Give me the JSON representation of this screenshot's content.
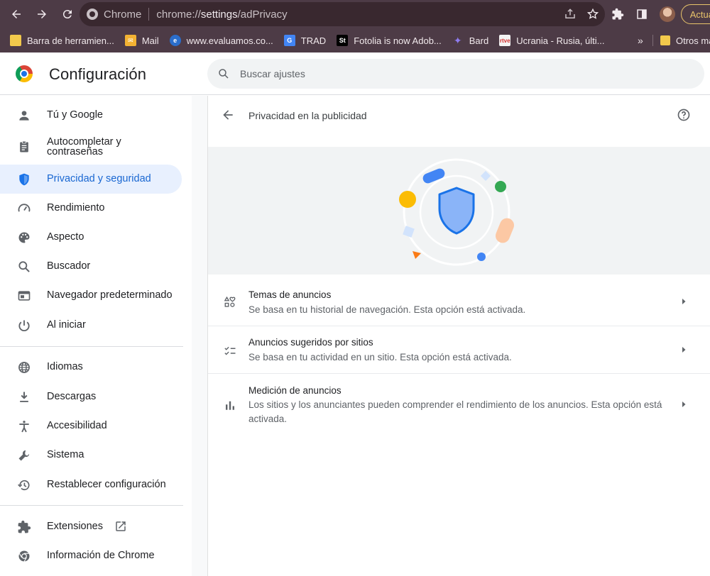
{
  "browser": {
    "omnibox": {
      "chip": "Chrome",
      "url_prefix": "chrome://",
      "url_host": "settings",
      "url_path": "/adPrivacy"
    },
    "update_label": "Actua"
  },
  "bookmarks": {
    "items": [
      {
        "label": "Barra de herramien...",
        "icon": "folder-icon",
        "color": "#f2c94c"
      },
      {
        "label": "Mail",
        "icon": "mail-icon",
        "color": "#f2b233"
      },
      {
        "label": "www.evaluamos.co...",
        "icon": "edge-e-icon",
        "color": "#2b6ecb"
      },
      {
        "label": "TRAD",
        "icon": "translate-icon",
        "color": "#4285f4"
      },
      {
        "label": "Fotolia is now Adob...",
        "icon": "stock-icon",
        "color": "#000000"
      },
      {
        "label": "Bard",
        "icon": "bard-sparkle-icon",
        "color": "#8e7cf0"
      },
      {
        "label": "Ucrania - Rusia, últi...",
        "icon": "rtve-icon",
        "color": "#f4f4f4"
      }
    ],
    "overflow": "»",
    "other_label": "Otros ma"
  },
  "settings": {
    "title": "Configuración",
    "search_placeholder": "Buscar ajustes"
  },
  "sidebar": {
    "items": [
      {
        "label": "Tú y Google",
        "icon": "person-icon"
      },
      {
        "label": "Autocompletar y contraseñas",
        "icon": "clipboard-icon"
      },
      {
        "label": "Privacidad y seguridad",
        "icon": "shield-icon",
        "active": true
      },
      {
        "label": "Rendimiento",
        "icon": "speedometer-icon"
      },
      {
        "label": "Aspecto",
        "icon": "palette-icon"
      },
      {
        "label": "Buscador",
        "icon": "search-icon"
      },
      {
        "label": "Navegador predeterminado",
        "icon": "browser-window-icon"
      },
      {
        "label": "Al iniciar",
        "icon": "power-icon"
      },
      {
        "label": "Idiomas",
        "icon": "globe-icon"
      },
      {
        "label": "Descargas",
        "icon": "download-icon"
      },
      {
        "label": "Accesibilidad",
        "icon": "accessibility-icon"
      },
      {
        "label": "Sistema",
        "icon": "wrench-icon"
      },
      {
        "label": "Restablecer configuración",
        "icon": "restore-icon"
      },
      {
        "label": "Extensiones",
        "icon": "puzzle-icon"
      },
      {
        "label": "Información de Chrome",
        "icon": "chrome-icon"
      }
    ]
  },
  "page": {
    "title": "Privacidad en la publicidad",
    "rows": [
      {
        "title": "Temas de anuncios",
        "subtitle": "Se basa en tu historial de navegación. Esta opción está activada.",
        "icon": "ad-topics-icon"
      },
      {
        "title": "Anuncios sugeridos por sitios",
        "subtitle": "Se basa en tu actividad en un sitio. Esta opción está activada.",
        "icon": "checklist-icon"
      },
      {
        "title": "Medición de anuncios",
        "subtitle": "Los sitios y los anunciantes pueden comprender el rendimiento de los anuncios. Esta opción está activada.",
        "icon": "bar-chart-icon"
      }
    ]
  },
  "colors": {
    "chrome_frame": "#4d3b46",
    "accent_blue": "#1a73e8",
    "active_nav_bg": "#e8f0fe",
    "active_nav_text": "#1967d2"
  }
}
